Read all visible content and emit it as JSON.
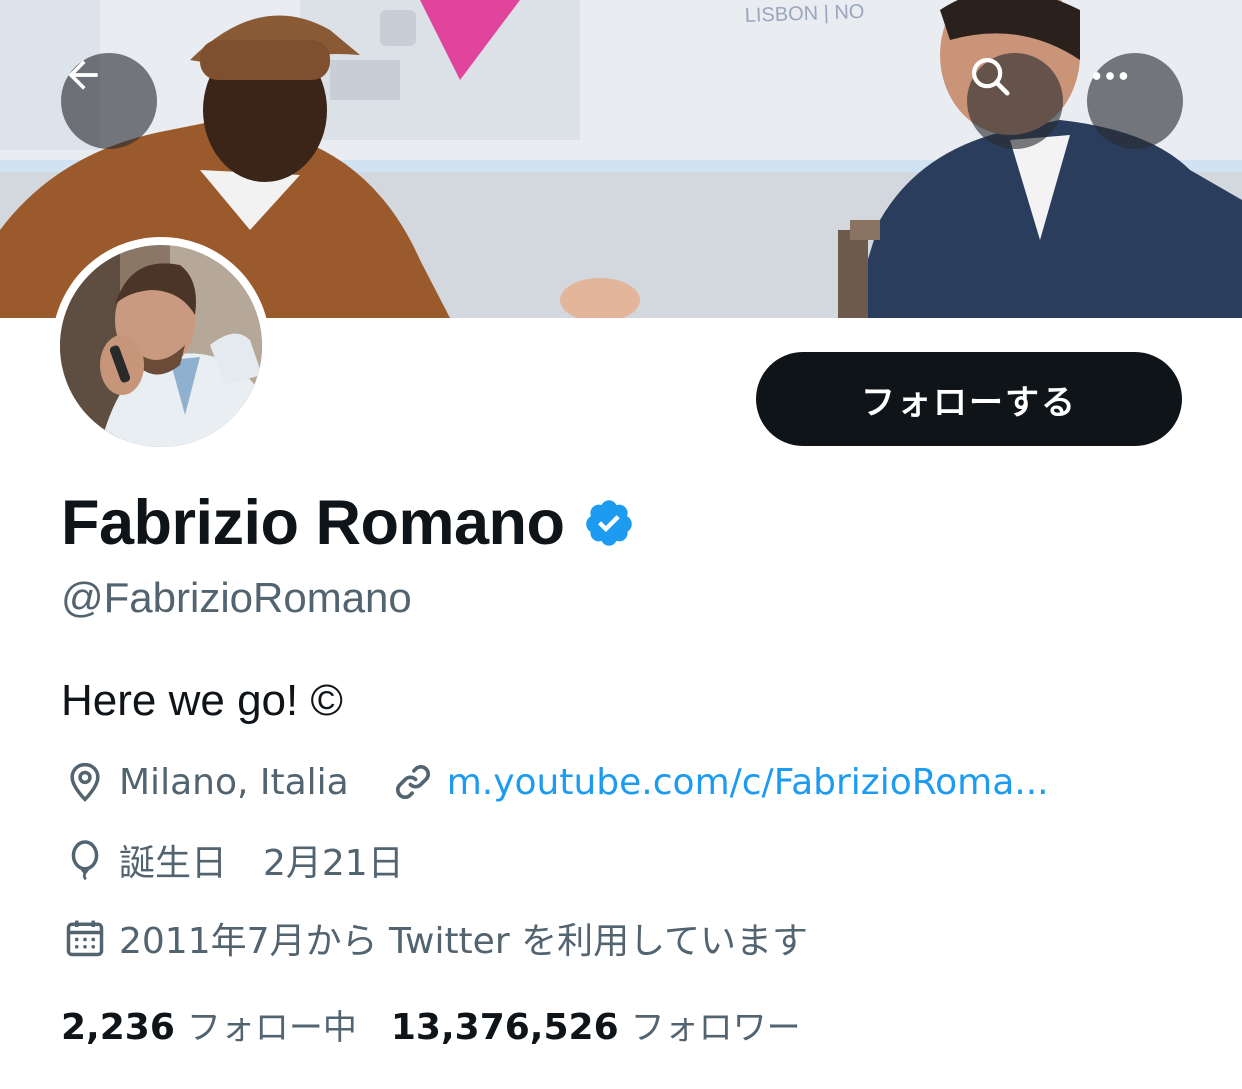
{
  "header": {
    "back_icon": "arrow-left-icon",
    "search_icon": "search-icon",
    "more_icon": "more-horizontal-icon"
  },
  "banner": {
    "screen_text": "LISBON | NO"
  },
  "profile": {
    "display_name": "Fabrizio Romano",
    "verified": true,
    "verified_color": "#1d9bf0",
    "handle": "@FabrizioRomano",
    "bio": "Here we go! ©",
    "location": "Milano, Italia",
    "url": "m.youtube.com/c/FabrizioRoma...",
    "birthday": "誕生日　2月21日",
    "joined": "2011年7月から Twitter を利用しています"
  },
  "actions": {
    "follow_label": "フォローする"
  },
  "stats": {
    "following_count": "2,236",
    "following_label": "フォロー中",
    "followers_count": "13,376,526",
    "followers_label": "フォロワー"
  },
  "colors": {
    "accent": "#1d9bf0",
    "text_primary": "#0f1419",
    "text_secondary": "#536471",
    "button_dark": "#0f1419"
  }
}
